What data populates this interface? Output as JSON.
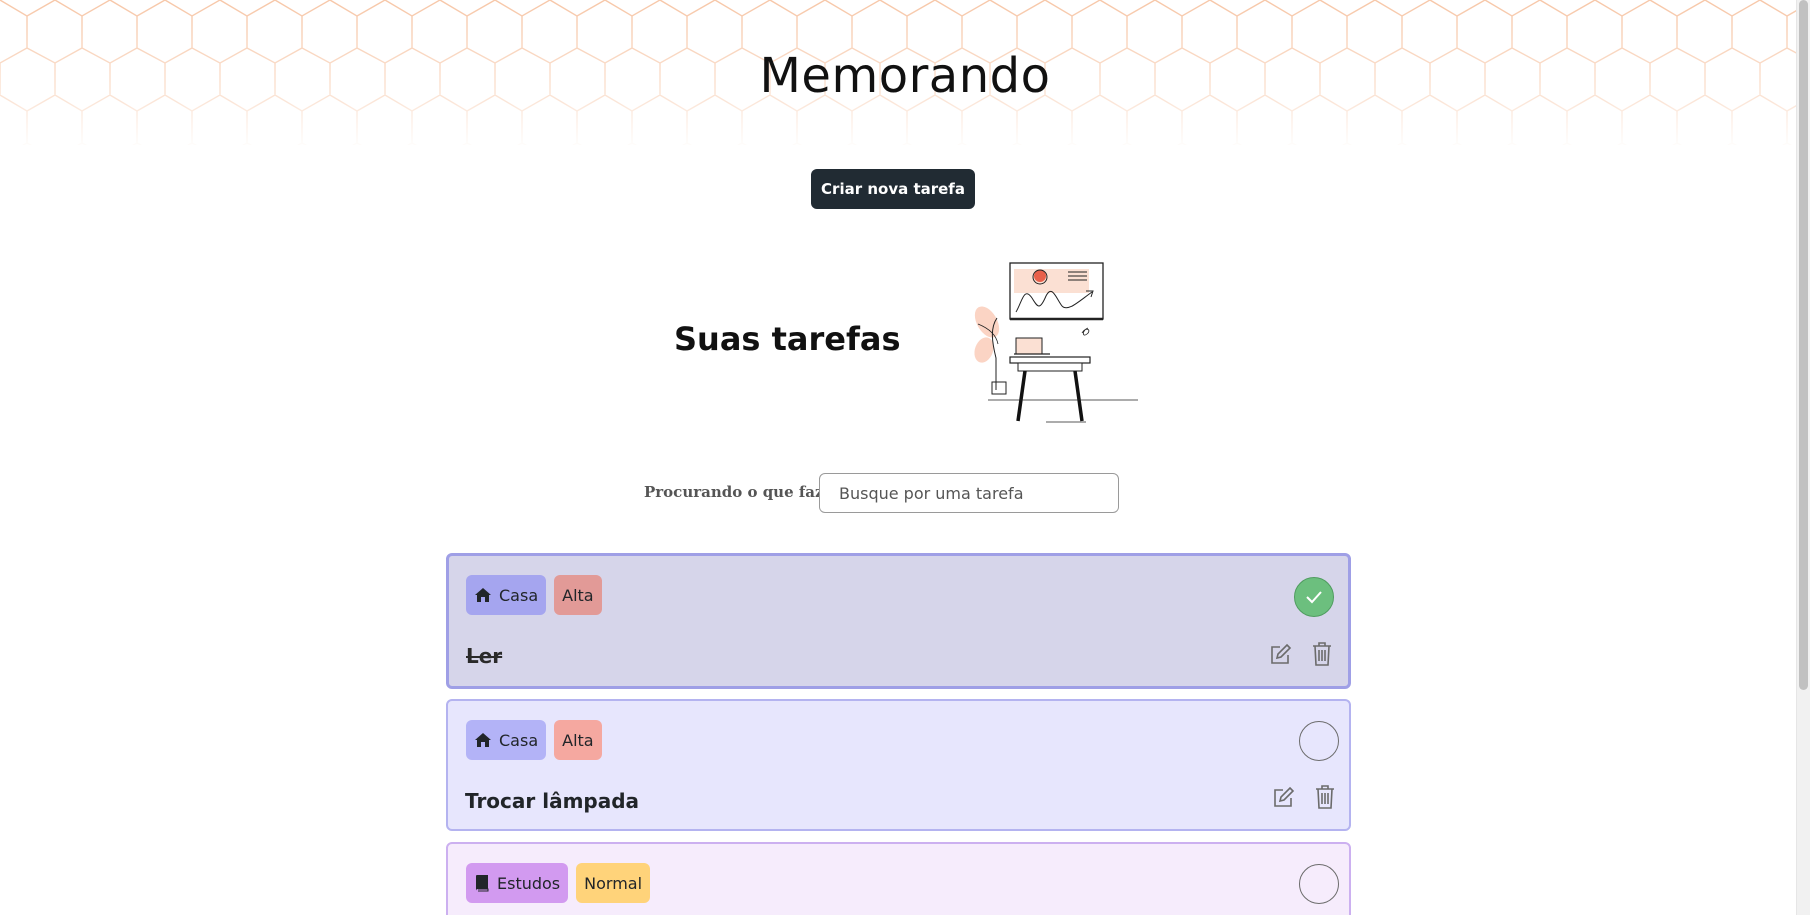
{
  "header": {
    "title": "Memorando"
  },
  "toolbar": {
    "create_label": "Criar nova tarefa"
  },
  "section": {
    "title": "Suas tarefas"
  },
  "search": {
    "label": "Procurando o que fazer?",
    "placeholder": "Busque por uma tarefa",
    "value": ""
  },
  "tasks": [
    {
      "name": "Ler",
      "category": {
        "label": "Casa",
        "icon": "home-icon"
      },
      "priority": "Alta",
      "completed": true
    },
    {
      "name": "Trocar lâmpada",
      "category": {
        "label": "Casa",
        "icon": "home-icon"
      },
      "priority": "Alta",
      "completed": false
    },
    {
      "category": {
        "label": "Estudos",
        "icon": "book-icon"
      },
      "priority": "Normal",
      "completed": false
    }
  ],
  "colors": {
    "accent_dark": "#212b33",
    "pattern": "#f7c7a8",
    "category_casa": "#b3b3f7",
    "category_estudos": "#d29af0",
    "priority_alta": "#f5a8a0",
    "priority_normal": "#ffd37a",
    "completed_check": "#6cbf7e"
  }
}
